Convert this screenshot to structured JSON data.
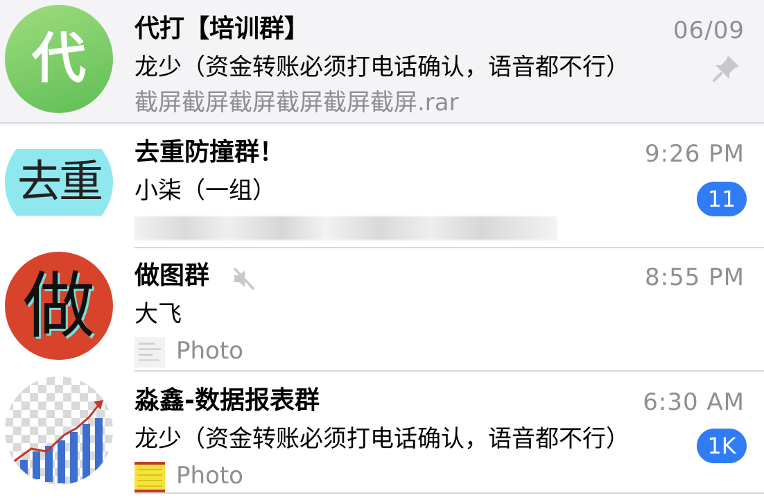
{
  "chats": [
    {
      "name": "代打【培训群】",
      "time": "06/09",
      "sender": "龙少（资金转账必须打电话确认，语音都不行）",
      "preview": "截屏截屏截屏截屏截屏截屏.rar",
      "avatar_text": "代",
      "avatar_color": "#7fcf6a",
      "pinned": true
    },
    {
      "name": "去重防撞群！",
      "time": "9:26 PM",
      "sender": "小柒（一组）",
      "badge": "11",
      "avatar_text": "去重",
      "avatar_color": "#8fe8ee"
    },
    {
      "name": "做图群",
      "time": "8:55 PM",
      "sender": "大飞",
      "preview": "Photo",
      "avatar_text": "做",
      "avatar_color": "#d8432c",
      "muted": true
    },
    {
      "name": "淼鑫-数据报表群",
      "time": "6:30 AM",
      "sender": "龙少（资金转账必须打电话确认，语音都不行）",
      "preview": "Photo",
      "badge": "1K",
      "avatar_icon": "bar-chart-growth"
    }
  ],
  "colors": {
    "accent": "#2f7cf6",
    "secondary_text": "#8e8e93",
    "pinned_row_bg": "#f4f4f6"
  }
}
